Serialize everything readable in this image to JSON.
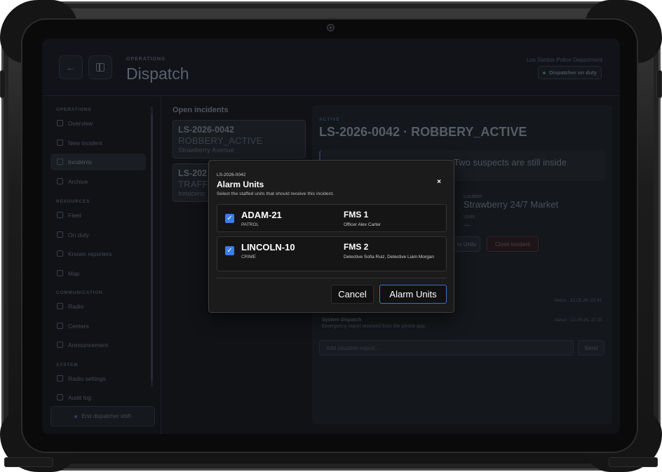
{
  "header": {
    "eyebrow": "OPERATIONS",
    "title": "Dispatch",
    "department": "Los Santos Police Department",
    "status_badge": "Dispatcher on duty"
  },
  "sidebar": {
    "sections": [
      {
        "label": "OPERATIONS"
      },
      {
        "label": "RESOURCES"
      },
      {
        "label": "COMMUNICATION"
      },
      {
        "label": "SYSTEM"
      }
    ],
    "items": [
      {
        "label": "Overview",
        "icon": "grid-icon"
      },
      {
        "label": "New incident",
        "icon": "plus-icon"
      },
      {
        "label": "Incidents",
        "icon": "alert-icon",
        "active": true
      },
      {
        "label": "Archive",
        "icon": "archive-icon"
      },
      {
        "label": "Fleet",
        "icon": "car-icon"
      },
      {
        "label": "On duty",
        "icon": "users-icon"
      },
      {
        "label": "Known reporters",
        "icon": "contact-icon"
      },
      {
        "label": "Map",
        "icon": "map-icon"
      },
      {
        "label": "Radio",
        "icon": "radio-icon"
      },
      {
        "label": "Centers",
        "icon": "tower-icon"
      },
      {
        "label": "Announcement",
        "icon": "megaphone-icon"
      },
      {
        "label": "Radio settings",
        "icon": "sliders-icon"
      },
      {
        "label": "Audit log",
        "icon": "log-icon"
      }
    ],
    "end_shift": "End dispatcher shift"
  },
  "incidents": {
    "title": "Open incidents",
    "items": [
      {
        "id": "LS-2026-0042",
        "type": "ROBBERY_ACTIVE",
        "location": "Strawberry Avenue"
      },
      {
        "id": "LS-202",
        "type": "TRAFF",
        "location": "Innocenc"
      }
    ]
  },
  "detail": {
    "eyebrow": "ACTIVE",
    "title": "LS-2026-0042 · ROBBERY_ACTIVE",
    "description_visible": "Two suspects are still inside",
    "location_label": "Location",
    "location": "Strawberry 24/7 Market",
    "units_label": "Units",
    "units_value": "—",
    "alarm_units_btn": "m Units",
    "close_btn": "Close incident",
    "log": [
      {
        "timestamp": "status · 12.05.26, 22:41"
      },
      {
        "author": "System Dispatch",
        "text": "Emergency report received from the phone app.",
        "timestamp": "status · 12.05.26, 22:35"
      }
    ],
    "report_placeholder": "Add situation report...",
    "send": "Send"
  },
  "modal": {
    "incident_id": "LS-2026-0042",
    "title": "Alarm Units",
    "subtitle": "Select the staffed units that should receive this incident.",
    "close_glyph": "×",
    "units": [
      {
        "name": "ADAM-21",
        "type": "PATROL",
        "fms": "FMS 1",
        "crew": "Officer Alex Carter",
        "checked": true
      },
      {
        "name": "LINCOLN-10",
        "type": "CRIME",
        "fms": "FMS 2",
        "crew": "Detective Sofia Ruiz, Detective Liam Morgan",
        "checked": true
      }
    ],
    "cancel": "Cancel",
    "confirm": "Alarm Units"
  },
  "colors": {
    "accent": "#3b7de8",
    "modal_bg": "#1b1b1c",
    "screen_bg": "#101216"
  }
}
